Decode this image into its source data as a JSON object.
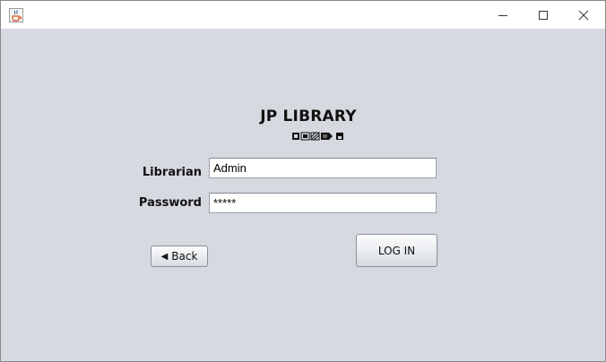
{
  "window": {
    "icon": "java-cup-icon",
    "controls": {
      "minimize": "—",
      "maximize": "☐",
      "close": "✕"
    }
  },
  "header": {
    "title": "JP LIBRARY"
  },
  "form": {
    "librarian_label": "Librarian",
    "librarian_value": "Admin",
    "password_label": "Password",
    "password_value": "*****"
  },
  "buttons": {
    "back_label": "Back",
    "back_icon": "◀",
    "login_label": "LOG IN"
  },
  "colors": {
    "background": "#d6d9df",
    "titlebar": "#ffffff"
  }
}
